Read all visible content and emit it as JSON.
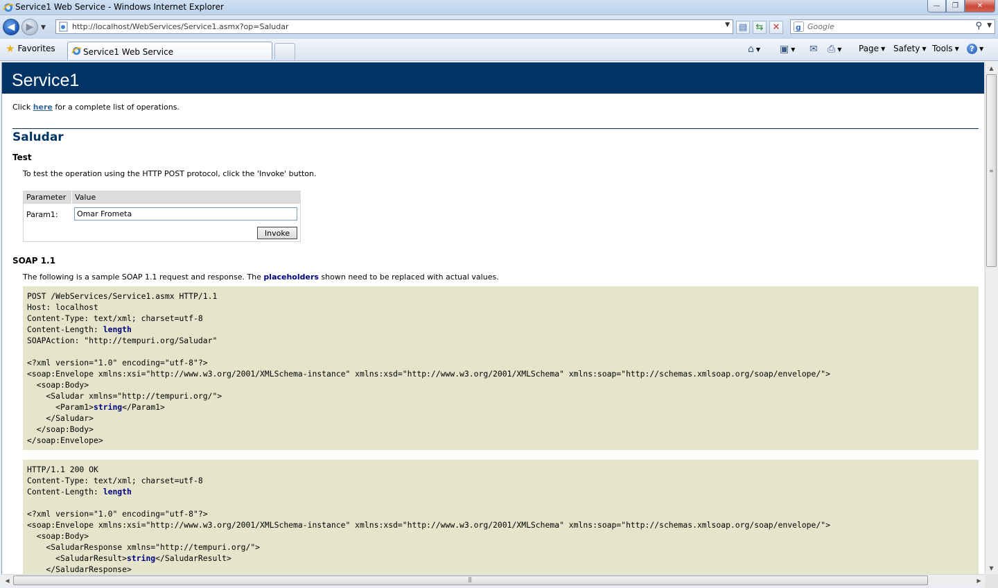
{
  "window": {
    "title": "Service1 Web Service - Windows Internet Explorer",
    "minimize_glyph": "—",
    "maximize_glyph": "❐",
    "close_glyph": "✕"
  },
  "address_bar": {
    "url": "http://localhost/WebServices/Service1.asmx?op=Saludar"
  },
  "search_box": {
    "placeholder": "Google"
  },
  "command_bar": {
    "favorites_label": "Favorites",
    "tab_title": "Service1 Web Service",
    "page_label": "Page",
    "safety_label": "Safety",
    "tools_label": "Tools"
  },
  "page": {
    "heading": "Service1",
    "intro_before": "Click ",
    "intro_link": "here",
    "intro_after": " for a complete list of operations.",
    "operation_name": "Saludar",
    "test_heading": "Test",
    "test_description": "To test the operation using the HTTP POST protocol, click the 'Invoke' button.",
    "table": {
      "col_parameter": "Parameter",
      "col_value": "Value",
      "param_name": "Param1:",
      "param_value": "Omar Frometa",
      "invoke_label": "Invoke"
    },
    "soap_heading": "SOAP 1.1",
    "soap_desc_before": "The following is a sample SOAP 1.1 request and response. The ",
    "soap_desc_placeholder": "placeholders",
    "soap_desc_after": " shown need to be replaced with actual values.",
    "request_lines": [
      {
        "text": "POST /WebServices/Service1.asmx HTTP/1.1"
      },
      {
        "text": "Host: localhost"
      },
      {
        "text": "Content-Type: text/xml; charset=utf-8"
      },
      {
        "text": "Content-Length: ",
        "ph": "length"
      },
      {
        "text": "SOAPAction: \"http://tempuri.org/Saludar\""
      },
      {
        "text": ""
      },
      {
        "text": "<?xml version=\"1.0\" encoding=\"utf-8\"?>"
      },
      {
        "text": "<soap:Envelope xmlns:xsi=\"http://www.w3.org/2001/XMLSchema-instance\" xmlns:xsd=\"http://www.w3.org/2001/XMLSchema\" xmlns:soap=\"http://schemas.xmlsoap.org/soap/envelope/\">"
      },
      {
        "text": "  <soap:Body>"
      },
      {
        "text": "    <Saludar xmlns=\"http://tempuri.org/\">"
      },
      {
        "text": "      <Param1>",
        "ph": "string",
        "after": "</Param1>"
      },
      {
        "text": "    </Saludar>"
      },
      {
        "text": "  </soap:Body>"
      },
      {
        "text": "</soap:Envelope>"
      }
    ],
    "response_lines": [
      {
        "text": "HTTP/1.1 200 OK"
      },
      {
        "text": "Content-Type: text/xml; charset=utf-8"
      },
      {
        "text": "Content-Length: ",
        "ph": "length"
      },
      {
        "text": ""
      },
      {
        "text": "<?xml version=\"1.0\" encoding=\"utf-8\"?>"
      },
      {
        "text": "<soap:Envelope xmlns:xsi=\"http://www.w3.org/2001/XMLSchema-instance\" xmlns:xsd=\"http://www.w3.org/2001/XMLSchema\" xmlns:soap=\"http://schemas.xmlsoap.org/soap/envelope/\">"
      },
      {
        "text": "  <soap:Body>"
      },
      {
        "text": "    <SaludarResponse xmlns=\"http://tempuri.org/\">"
      },
      {
        "text": "      <SaludarResult>",
        "ph": "string",
        "after": "</SaludarResult>"
      },
      {
        "text": "    </SaludarResponse>"
      }
    ]
  },
  "colors": {
    "heading_bar": "#003366",
    "code_background": "#e5e5cc",
    "placeholder_text": "#000080"
  },
  "icons": [
    "ie-logo-icon",
    "back-arrow-icon",
    "forward-arrow-icon",
    "page-icon",
    "compatibility-view-icon",
    "refresh-icon",
    "stop-icon",
    "google-icon",
    "search-icon",
    "favorites-star-icon",
    "home-icon",
    "feeds-icon",
    "mail-icon",
    "print-icon",
    "help-icon"
  ]
}
